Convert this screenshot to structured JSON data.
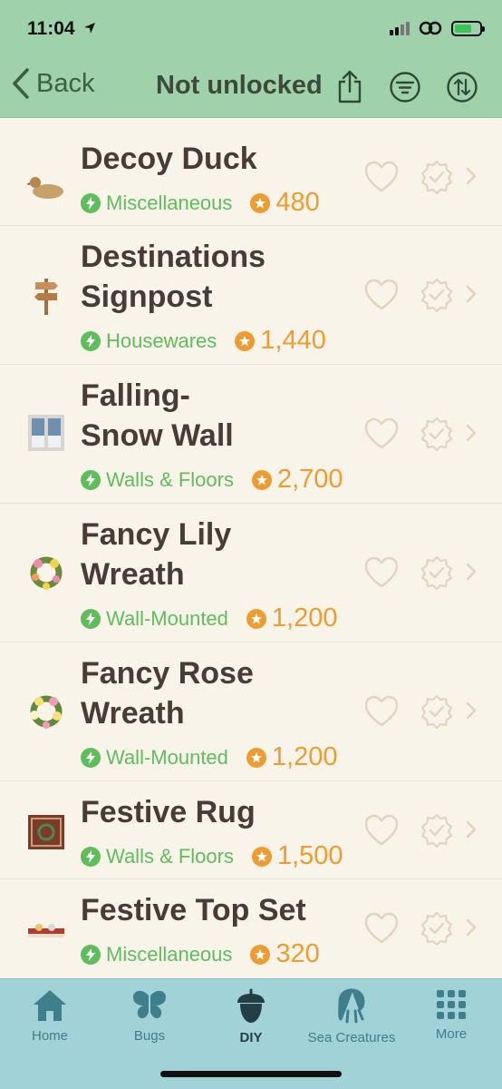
{
  "status_bar": {
    "time": "11:04",
    "location_icon": "location-arrow-icon",
    "battery_color": "#3fc35b"
  },
  "nav": {
    "back_label": "Back",
    "title": "Not unlocked",
    "icons": [
      "share-icon",
      "filter-icon",
      "sort-icon"
    ]
  },
  "items": [
    {
      "name": "Decoy Duck",
      "category": "Miscellaneous",
      "price": "480",
      "thumb": "duck-decoy-icon"
    },
    {
      "name": "Destinations\nSignpost",
      "category": "Housewares",
      "price": "1,440",
      "thumb": "signpost-icon"
    },
    {
      "name": "Falling-\nSnow Wall",
      "category": "Walls & Floors",
      "price": "2,700",
      "thumb": "snow-wall-icon"
    },
    {
      "name": "Fancy Lily\nWreath",
      "category": "Wall-Mounted",
      "price": "1,200",
      "thumb": "lily-wreath-icon"
    },
    {
      "name": "Fancy Rose\nWreath",
      "category": "Wall-Mounted",
      "price": "1,200",
      "thumb": "rose-wreath-icon"
    },
    {
      "name": "Festive Rug",
      "category": "Walls & Floors",
      "price": "1,500",
      "thumb": "festive-rug-icon"
    },
    {
      "name": "Festive Top Set",
      "category": "Miscellaneous",
      "price": "320",
      "thumb": "top-set-icon"
    }
  ],
  "tabs": [
    {
      "label": "Home",
      "icon": "house-icon",
      "active": false
    },
    {
      "label": "Bugs",
      "icon": "butterfly-icon",
      "active": false
    },
    {
      "label": "DIY",
      "icon": "acorn-icon",
      "active": true
    },
    {
      "label": "Sea Creatures",
      "icon": "octopus-icon",
      "active": false
    },
    {
      "label": "More",
      "icon": "grid-icon",
      "active": false
    }
  ],
  "colors": {
    "header": "#9fd1aa",
    "tab_bar": "#a0d2d7",
    "category": "#5fbd5c",
    "price": "#ee9c32",
    "title_text": "#4a3b36"
  }
}
